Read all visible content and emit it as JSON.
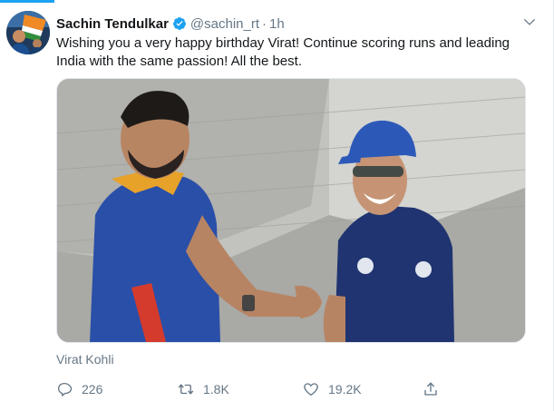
{
  "tweet": {
    "author_name": "Sachin Tendulkar",
    "handle": "@sachin_rt",
    "separator": "·",
    "timestamp": "1h",
    "text": "Wishing you a very happy birthday Virat! Continue scoring runs and leading India with the same passion! All the best.",
    "photo_caption": "Virat Kohli"
  },
  "actions": {
    "reply_count": "226",
    "retweet_count": "1.8K",
    "like_count": "19.2K"
  },
  "icons": {
    "verified": "verified-badge-icon",
    "more": "chevron-down-icon",
    "reply": "reply-icon",
    "retweet": "retweet-icon",
    "like": "heart-icon",
    "share": "share-icon"
  },
  "colors": {
    "accent": "#1da1f2",
    "secondary_text": "#657786",
    "primary_text": "#14171a"
  }
}
